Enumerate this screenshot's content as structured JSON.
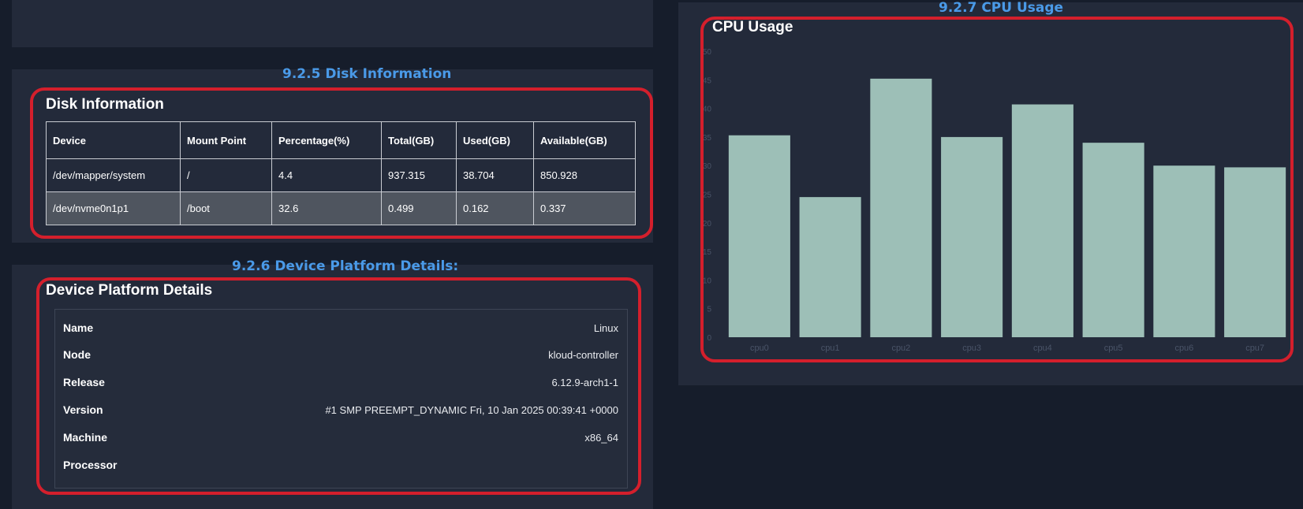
{
  "captions": {
    "disk": "9.2.5 Disk Information",
    "platform": "9.2.6 Device Platform Details:",
    "cpu": "9.2.7 CPU Usage"
  },
  "disk": {
    "title": "Disk Information",
    "columns": [
      "Device",
      "Mount Point",
      "Percentage(%)",
      "Total(GB)",
      "Used(GB)",
      "Available(GB)"
    ],
    "rows": [
      [
        "/dev/mapper/system",
        "/",
        "4.4",
        "937.315",
        "38.704",
        "850.928"
      ],
      [
        "/dev/nvme0n1p1",
        "/boot",
        "32.6",
        "0.499",
        "0.162",
        "0.337"
      ]
    ]
  },
  "platform": {
    "title": "Device Platform Details",
    "rows": [
      {
        "key": "Name",
        "value": "Linux"
      },
      {
        "key": "Node",
        "value": "kloud-controller"
      },
      {
        "key": "Release",
        "value": "6.12.9-arch1-1"
      },
      {
        "key": "Version",
        "value": "#1 SMP PREEMPT_DYNAMIC Fri, 10 Jan 2025 00:39:41 +0000"
      },
      {
        "key": "Machine",
        "value": "x86_64"
      },
      {
        "key": "Processor",
        "value": ""
      }
    ]
  },
  "cpu": {
    "title": "CPU Usage"
  },
  "colors": {
    "bar": "#9dbfb7",
    "highlight": "#d41f2c",
    "caption": "#4a9ae8",
    "axis_text": "#4a5468"
  },
  "chart_data": {
    "type": "bar",
    "title": "CPU Usage",
    "categories": [
      "cpu0",
      "cpu1",
      "cpu2",
      "cpu3",
      "cpu4",
      "cpu5",
      "cpu6",
      "cpu7"
    ],
    "values": [
      35.3,
      24.5,
      45.2,
      35.0,
      40.7,
      34.0,
      30.0,
      29.7
    ],
    "ylim": [
      0,
      50
    ],
    "yticks": [
      0,
      5,
      10,
      15,
      20,
      25,
      30,
      35,
      40,
      45,
      50
    ],
    "grid": false,
    "legend": "none"
  }
}
